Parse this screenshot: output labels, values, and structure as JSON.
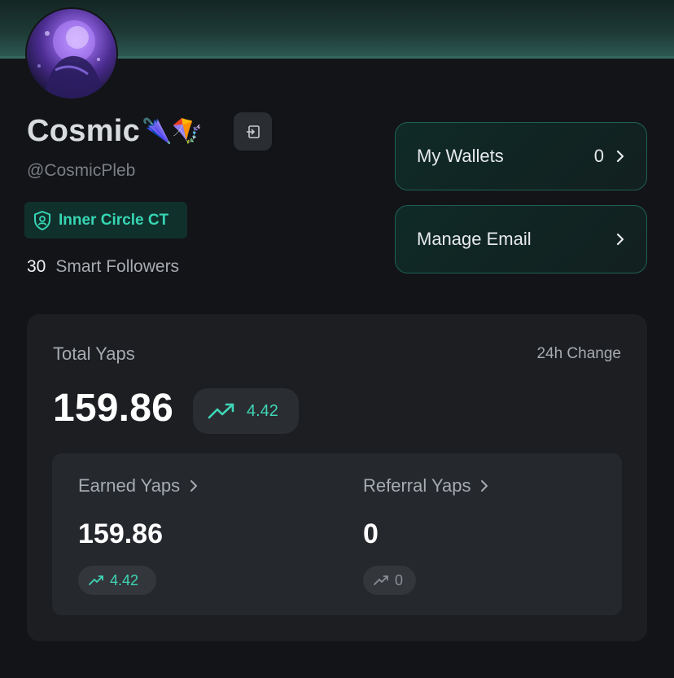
{
  "profile": {
    "name": "Cosmic",
    "name_emoji": "🌂🪁",
    "handle": "@CosmicPleb",
    "badge": "Inner Circle CT",
    "followers_count": "30",
    "followers_label": "Smart Followers"
  },
  "actions": {
    "wallets_label": "My Wallets",
    "wallets_count": "0",
    "email_label": "Manage Email"
  },
  "stats": {
    "total_label": "Total Yaps",
    "change_label": "24h Change",
    "total_value": "159.86",
    "total_change": "4.42",
    "earned_label": "Earned Yaps",
    "earned_value": "159.86",
    "earned_change": "4.42",
    "referral_label": "Referral Yaps",
    "referral_value": "0",
    "referral_change": "0"
  },
  "icons": {
    "logout": "logout-icon",
    "badge": "shield-user-icon",
    "trend": "trending-up-icon",
    "chevron": "chevron-right-icon"
  },
  "colors": {
    "accent": "#3fd6b6",
    "background": "#131417",
    "card": "#1c1e21",
    "button_border": "#1f6155"
  }
}
